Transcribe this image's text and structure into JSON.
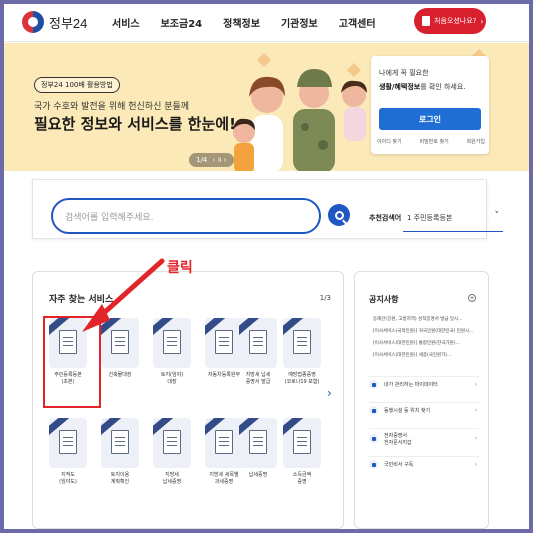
{
  "header": {
    "logo_text": "정부24",
    "nav": [
      "서비스",
      "보조금24",
      "정책정보",
      "기관정보",
      "고객센터"
    ],
    "cta_label": "처음오셨나요?"
  },
  "banner": {
    "pill": "정부24 100배 활용방법",
    "subtitle": "국가 수호와 발전을 위해 헌신하신 분들께",
    "title": "필요한 정보와 서비스를 한눈에!",
    "pager": "1/4",
    "pager_controls": "‹ ॥ ›"
  },
  "login": {
    "line1": "나에게 꼭 필요한",
    "line2_bold": "생활/혜택정보",
    "line2_rest": "를 확인 하세요.",
    "button": "로그인",
    "links": [
      "아이디 찾기",
      "비밀번호 찾기",
      "회원가입"
    ]
  },
  "search": {
    "placeholder": "검색어를 입력해주세요.",
    "reco_label": "추천검색어",
    "reco_value": "1  주민등록등본"
  },
  "frequent": {
    "title": "자주 찾는 서비스",
    "page": "1/3",
    "next": "›",
    "items": [
      {
        "label": "주민등록등본\n(초본)"
      },
      {
        "label": "건축물대장"
      },
      {
        "label": "토지(임야)\n대장"
      },
      {
        "label": "자동차등록원부"
      },
      {
        "label": "지방세 납세\n증명서 발급"
      },
      {
        "label": "예방접종증명\n(코로나19 포함)"
      },
      {
        "label": "지적도\n(임야도)"
      },
      {
        "label": "토지이용\n계획확인"
      },
      {
        "label": "지방세\n납세증명"
      },
      {
        "label": "지방세 세목별\n과세증명"
      },
      {
        "label": "납세증명"
      },
      {
        "label": "소득금액\n증명"
      }
    ]
  },
  "annotation": {
    "click_label": "클릭"
  },
  "notices": {
    "title": "공지사항",
    "more": "+",
    "lines": [
      "동해안(강원, 고흥지역) 성적증명서 발급 일시...",
      "[이사서비스(국적민원)] 귀국민원(대한민국) 민원시...",
      "[이사서비스(대한민원)] 통합민원(한국가원)...",
      "[이사서비스(대한민원)] 세종(국민원가)..."
    ],
    "quick": [
      {
        "label": "내가 관리하는 마이데이터"
      },
      {
        "label": "동행시설 등 위치 찾기"
      },
      {
        "label": "전자증명서\n전자문서지갑"
      },
      {
        "label": "국민비서 구독"
      }
    ]
  }
}
